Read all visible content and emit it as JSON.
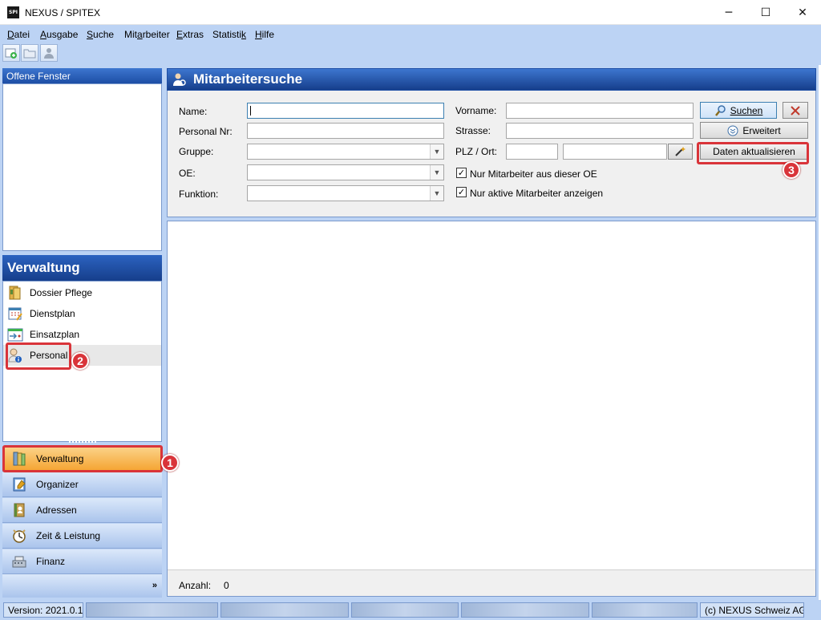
{
  "window": {
    "app_icon_text": "SPI",
    "title": "NEXUS / SPITEX",
    "minimize": "─",
    "maximize": "☐",
    "close": "✕"
  },
  "menu": [
    {
      "pre": "",
      "ul": "D",
      "post": "atei"
    },
    {
      "pre": "",
      "ul": "A",
      "post": "usgabe"
    },
    {
      "pre": "",
      "ul": "S",
      "post": "uche"
    },
    {
      "pre": "Mit",
      "ul": "a",
      "post": "rbeiter"
    },
    {
      "pre": "",
      "ul": "E",
      "post": "xtras"
    },
    {
      "pre": "Statisti",
      "ul": "k",
      "post": ""
    },
    {
      "pre": "",
      "ul": "H",
      "post": "ilfe"
    }
  ],
  "toolbar": {
    "icons": [
      "new-window-icon",
      "folder-icon",
      "user-lookup-icon"
    ]
  },
  "open_windows": {
    "header": "Offene Fenster"
  },
  "verwaltung": {
    "header": "Verwaltung",
    "items": [
      {
        "label": "Dossier Pflege",
        "icon": "dossier-icon"
      },
      {
        "label": "Dienstplan",
        "icon": "calendar-icon"
      },
      {
        "label": "Einsatzplan",
        "icon": "schedule-icon"
      },
      {
        "label": "Personal",
        "icon": "person-info-icon"
      }
    ]
  },
  "nav_buttons": [
    {
      "label": "Verwaltung",
      "icon": "books-icon",
      "active": true
    },
    {
      "label": "Organizer",
      "icon": "notebook-icon",
      "active": false
    },
    {
      "label": "Adressen",
      "icon": "address-book-icon",
      "active": false
    },
    {
      "label": "Zeit & Leistung",
      "icon": "clock-icon",
      "active": false
    },
    {
      "label": "Finanz",
      "icon": "cash-register-icon",
      "active": false
    }
  ],
  "nav_overflow": "»",
  "search": {
    "title": "Mitarbeitersuche",
    "labels": {
      "name": "Name:",
      "personal_nr": "Personal Nr:",
      "gruppe": "Gruppe:",
      "oe": "OE:",
      "funktion": "Funktion:",
      "vorname": "Vorname:",
      "strasse": "Strasse:",
      "plz_ort": "PLZ / Ort:"
    },
    "values": {
      "name": "",
      "personal_nr": "",
      "gruppe": "",
      "oe": "",
      "funktion": "",
      "vorname": "",
      "strasse": "",
      "plz": "",
      "ort": ""
    },
    "checkboxes": [
      {
        "label": "Nur Mitarbeiter aus dieser OE",
        "checked": true
      },
      {
        "label": "Nur aktive Mitarbeiter anzeigen",
        "checked": true
      }
    ],
    "buttons": {
      "suchen": "Suchen",
      "erweitert": "Erweitert",
      "daten_aktualisieren": "Daten aktualisieren"
    }
  },
  "results": {
    "count_label": "Anzahl:",
    "count": "0"
  },
  "statusbar": {
    "version": "Version: 2021.0.1",
    "copyright": "(c) NEXUS Schweiz AG"
  },
  "annotations": [
    "1",
    "2",
    "3"
  ],
  "colors": {
    "accent": "#1d4ea5",
    "panel_bg": "#bcd3f4",
    "highlight": "#d9343a",
    "active_nav": "#f5a431"
  }
}
